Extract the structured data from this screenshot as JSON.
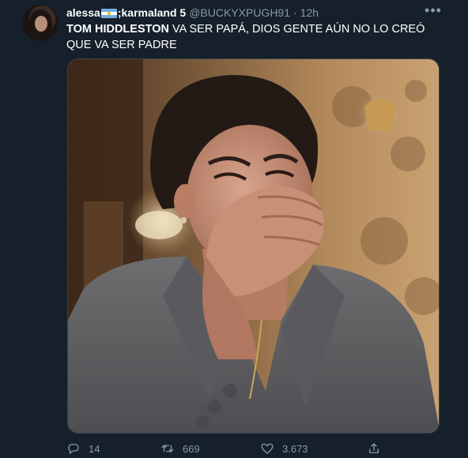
{
  "tweet": {
    "display_name": "alessa",
    "display_name_suffix": ";karmaland 5",
    "handle": "@BUCKYXPUGH91",
    "separator": "·",
    "time": "12h",
    "more_label": "•••",
    "text_bold": "TOM HIDDLESTON",
    "text_rest": " VA SER PAPÁ, DIOS GENTE AÚN NO LO CREÓ QUE VA SER PADRE",
    "media_alt": "",
    "replies": "14",
    "retweets": "669",
    "likes": "3.673"
  },
  "icons": {
    "reply": "reply-icon",
    "retweet": "retweet-icon",
    "like": "heart-icon",
    "share": "share-icon",
    "more": "more-icon",
    "flag": "argentina-flag-icon"
  },
  "colors": {
    "background": "#15202b",
    "secondary_text": "#8899a6",
    "primary_text": "#ffffff",
    "border": "#38444d"
  }
}
